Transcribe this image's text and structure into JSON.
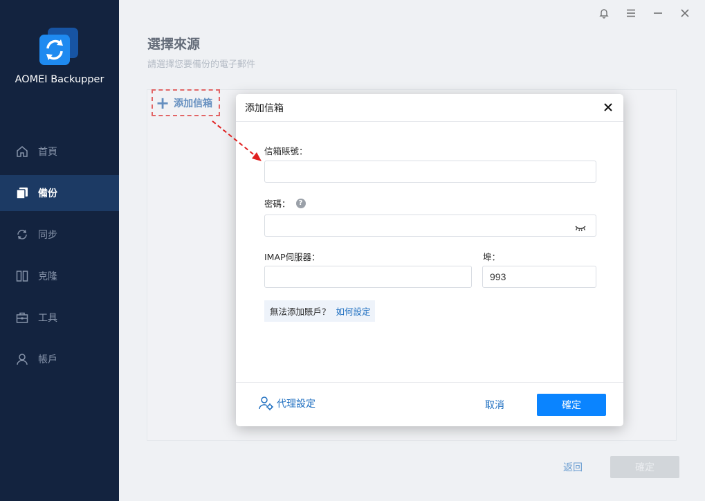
{
  "app": {
    "name": "AOMEI Backupper"
  },
  "sidebar": {
    "items": [
      {
        "label": "首頁",
        "icon": "home-icon"
      },
      {
        "label": "備份",
        "icon": "backup-icon",
        "active": true
      },
      {
        "label": "同步",
        "icon": "sync-icon"
      },
      {
        "label": "克隆",
        "icon": "clone-icon"
      },
      {
        "label": "工具",
        "icon": "toolbox-icon"
      },
      {
        "label": "帳戶",
        "icon": "user-icon"
      }
    ]
  },
  "main": {
    "title": "選擇來源",
    "subtitle": "請選擇您要備份的電子郵件",
    "add_mail_label": "添加信箱",
    "back_label": "返回",
    "confirm_label": "確定"
  },
  "dialog": {
    "title": "添加信箱",
    "email_label": "信箱賬號：",
    "email_value": "",
    "password_label": "密碼：",
    "password_value": "",
    "imap_label": "IMAP伺服器：",
    "imap_value": "",
    "port_label": "埠：",
    "port_value": "993",
    "hint_text": "無法添加賬戶？",
    "hint_link": "如何設定",
    "proxy_label": "代理設定",
    "cancel_label": "取消",
    "ok_label": "確定"
  },
  "colors": {
    "sidebar_bg": "#13233f",
    "sidebar_active": "#1c3a64",
    "accent": "#0a84ff",
    "link": "#1f6fc0",
    "highlight_dash": "#e02020"
  }
}
